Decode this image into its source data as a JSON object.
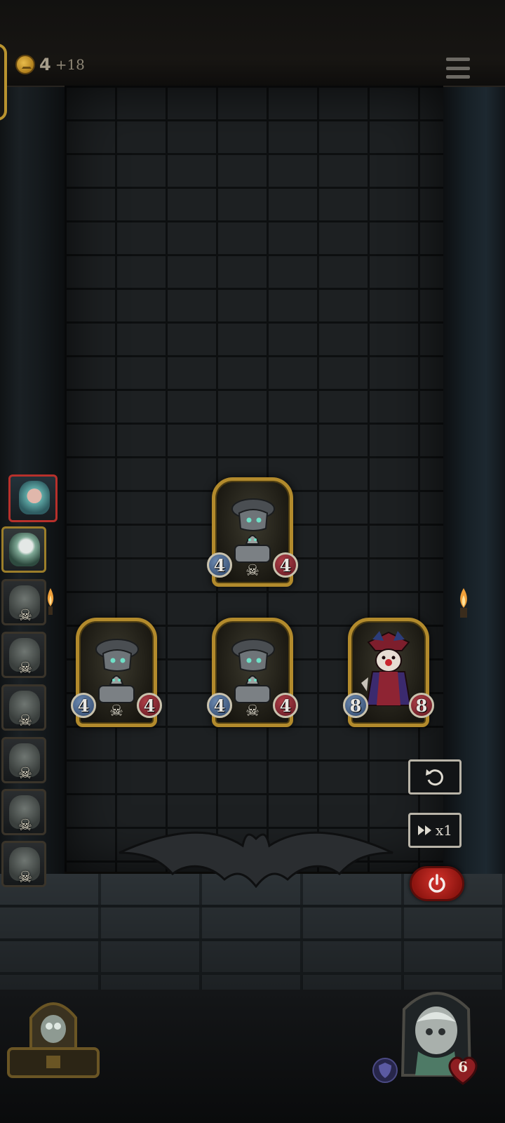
{
  "hud": {
    "coins": "4",
    "coin_income": "+18",
    "coin_icon": "crown-coin-icon",
    "menu_icon": "hamburger-menu-icon"
  },
  "roster": [
    {
      "name": "roster-slot-elf",
      "state": "active",
      "dead": false
    },
    {
      "name": "roster-slot-ghost-hero",
      "state": "current",
      "dead": false
    },
    {
      "name": "roster-slot-3",
      "state": "defeated",
      "dead": true
    },
    {
      "name": "roster-slot-4",
      "state": "defeated",
      "dead": true
    },
    {
      "name": "roster-slot-5",
      "state": "defeated",
      "dead": true
    },
    {
      "name": "roster-slot-6",
      "state": "defeated",
      "dead": true
    },
    {
      "name": "roster-slot-7",
      "state": "defeated",
      "dead": true
    },
    {
      "name": "roster-slot-8",
      "state": "defeated",
      "dead": true
    }
  ],
  "board": {
    "units": [
      {
        "kind": "bell",
        "attack": "4",
        "health": "4"
      },
      {
        "kind": "bell",
        "attack": "4",
        "health": "4"
      },
      {
        "kind": "bell",
        "attack": "4",
        "health": "4"
      },
      {
        "kind": "clown",
        "attack": "8",
        "health": "8"
      }
    ]
  },
  "controls": {
    "undo_icon": "undo-icon",
    "speed_icon": "fast-forward-icon",
    "speed_label": "x1",
    "power_icon": "power-icon"
  },
  "player": {
    "health": "6",
    "shield_icon": "shield-icon",
    "heart_icon": "heart-icon"
  },
  "colors": {
    "card_border": "#b28a2c",
    "attack": "#2d4468",
    "health": "#5d1720",
    "power_button": "#d2322b",
    "active_roster": "#b7302b"
  }
}
